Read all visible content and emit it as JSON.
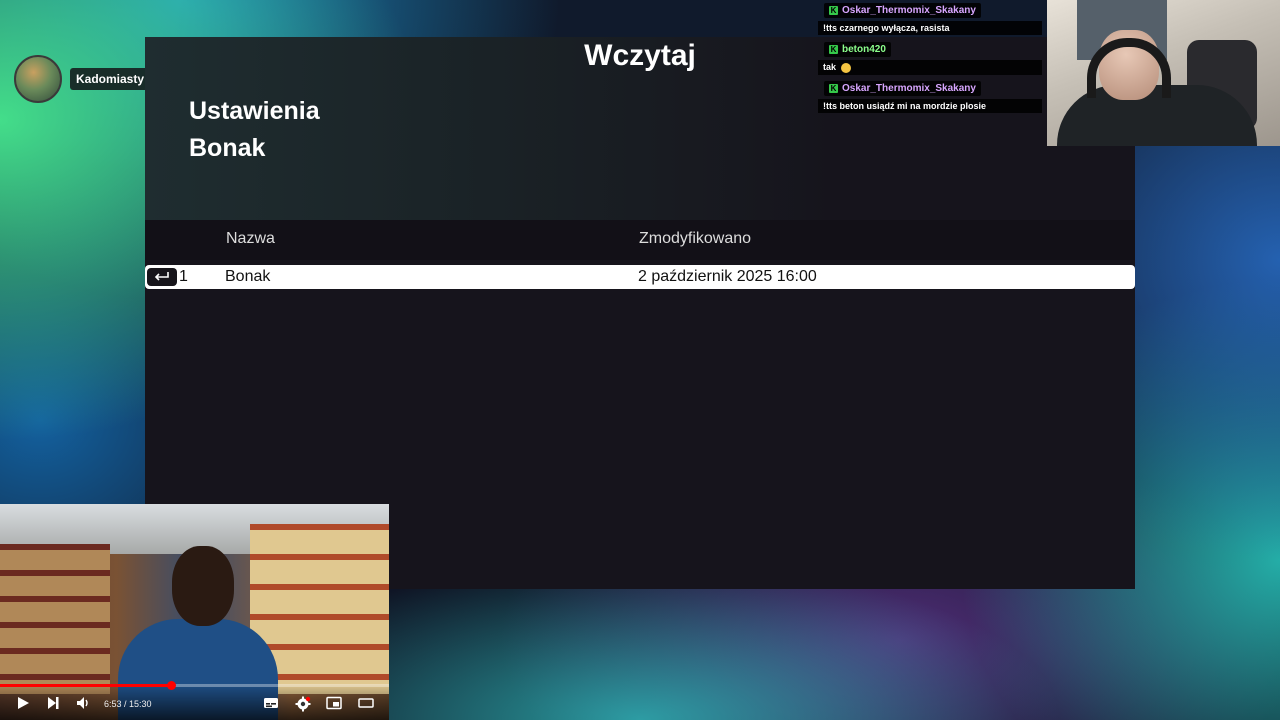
{
  "streamer": {
    "name": "Kadomiasty"
  },
  "game": {
    "title": "Wczytaj",
    "heading_line1": "Ustawienia",
    "heading_line2": "Bonak",
    "columns": {
      "name": "Nazwa",
      "modified": "Zmodyfikowano"
    },
    "rows": [
      {
        "index": "1",
        "name": "Bonak",
        "modified": "2 październik 2025 16:00"
      }
    ]
  },
  "chat": [
    {
      "user": "Oskar_Thermomix_Skakany",
      "text": "!tts czarnego wyłącza, rasista",
      "color": "#d8a6ff"
    },
    {
      "user": "beton420",
      "text": "tak",
      "color": "#8cff8c"
    },
    {
      "user": "Oskar_Thermomix_Skakany",
      "text": "!tts beton usiądź mi na mordzie plosie",
      "color": "#d8a6ff"
    }
  ],
  "video": {
    "time": "6:53 / 15:30",
    "progress": 0.44
  },
  "icons": {
    "enter": "enter-key-icon",
    "play": "play-icon",
    "next": "next-icon",
    "volume": "volume-icon",
    "subtitles": "subtitles-icon",
    "settings": "settings-icon",
    "miniplayer": "miniplayer-icon",
    "theater": "theater-icon"
  }
}
